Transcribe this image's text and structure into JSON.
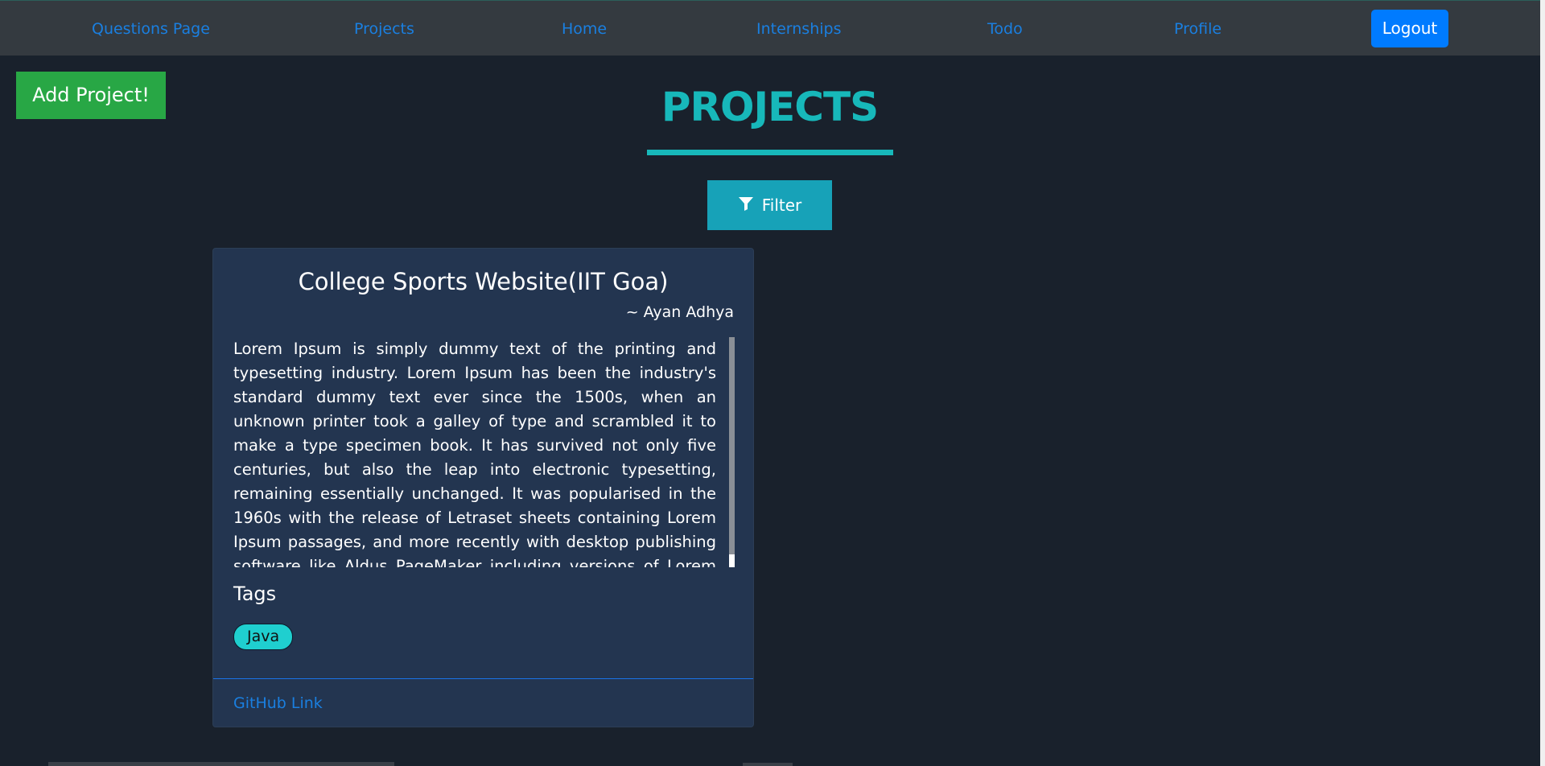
{
  "nav": {
    "links": [
      "Questions Page",
      "Projects",
      "Home",
      "Internships",
      "Todo",
      "Profile"
    ],
    "logout_label": "Logout"
  },
  "toolbar": {
    "add_project_label": "Add Project!",
    "filter_label": "Filter",
    "filter_icon": "filter-icon"
  },
  "page": {
    "title": "PROJECTS"
  },
  "projects": [
    {
      "title": "College Sports Website(IIT Goa)",
      "author": "~ Ayan Adhya",
      "description": "Lorem Ipsum is simply dummy text of the printing and typesetting industry. Lorem Ipsum has been the industry's standard dummy text ever since the 1500s, when an unknown printer took a galley of type and scrambled it to make a type specimen book. It has survived not only five centuries, but also the leap into electronic typesetting, remaining essentially unchanged. It was popularised in the 1960s with the release of Letraset sheets containing Lorem Ipsum passages, and more recently with desktop publishing software like Aldus PageMaker including versions of Lorem Ipsum.",
      "tags_heading": "Tags",
      "tags": [
        "Java"
      ],
      "link_label": "GitHub Link"
    }
  ],
  "colors": {
    "background": "#19212c",
    "navbar": "#343a40",
    "link": "#1a7fe0",
    "accent_teal": "#17b8ba",
    "add_button": "#28a745",
    "logout_button": "#007bff",
    "filter_button": "#17a2b8",
    "card": "#233550",
    "tag": "#1fcfcf"
  }
}
